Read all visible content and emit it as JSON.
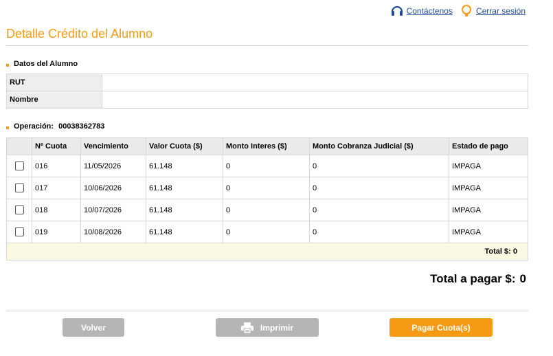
{
  "header": {
    "contact_label": "Contáctenos",
    "logout_label": "Cerrar sesión",
    "title": "Detalle Crédito del Alumno"
  },
  "student_section": {
    "title": "Datos del Alumno",
    "rows": [
      {
        "label": "RUT",
        "value": ""
      },
      {
        "label": "Nombre",
        "value": ""
      }
    ]
  },
  "operation": {
    "label": "Operación:",
    "number": "00038362783"
  },
  "installments": {
    "headers": [
      "",
      "Nº Cuota",
      "Vencimiento",
      "Valor Cuota ($)",
      "Monto Interes ($)",
      "Monto Cobranza Judicial ($)",
      "Estado de pago"
    ],
    "rows": [
      {
        "cuota": "016",
        "vencimiento": "11/05/2026",
        "valor": "61.148",
        "interes": "0",
        "cobranza": "0",
        "estado": "IMPAGA"
      },
      {
        "cuota": "017",
        "vencimiento": "10/06/2026",
        "valor": "61.148",
        "interes": "0",
        "cobranza": "0",
        "estado": "IMPAGA"
      },
      {
        "cuota": "018",
        "vencimiento": "10/07/2026",
        "valor": "61.148",
        "interes": "0",
        "cobranza": "0",
        "estado": "IMPAGA"
      },
      {
        "cuota": "019",
        "vencimiento": "10/08/2026",
        "valor": "61.148",
        "interes": "0",
        "cobranza": "0",
        "estado": "IMPAGA"
      }
    ],
    "total_label": "Total $: 0"
  },
  "grand_total": {
    "label": "Total a pagar $:",
    "value": "0"
  },
  "buttons": {
    "back": "Volver",
    "print": "Imprimir",
    "pay": "Pagar Cuota(s)"
  },
  "colors": {
    "accent": "#f39c12",
    "link": "#1f4e9c",
    "disabled_button": "#b5b5b5"
  },
  "icons": {
    "contact": "headset-icon",
    "logout": "lightbulb-icon",
    "print": "printer-icon"
  }
}
